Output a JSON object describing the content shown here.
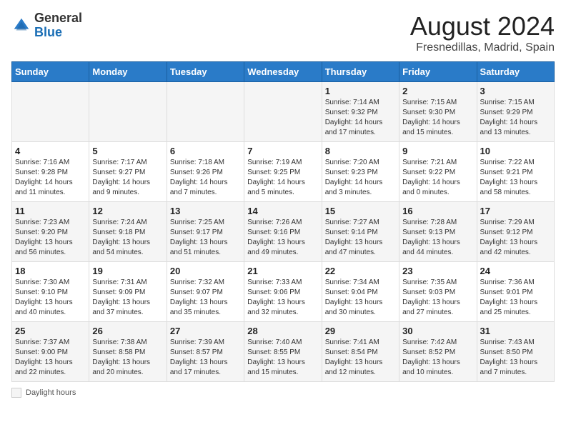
{
  "header": {
    "logo_general": "General",
    "logo_blue": "Blue",
    "month_year": "August 2024",
    "location": "Fresnedillas, Madrid, Spain"
  },
  "days_of_week": [
    "Sunday",
    "Monday",
    "Tuesday",
    "Wednesday",
    "Thursday",
    "Friday",
    "Saturday"
  ],
  "weeks": [
    [
      {
        "day": "",
        "info": ""
      },
      {
        "day": "",
        "info": ""
      },
      {
        "day": "",
        "info": ""
      },
      {
        "day": "",
        "info": ""
      },
      {
        "day": "1",
        "info": "Sunrise: 7:14 AM\nSunset: 9:32 PM\nDaylight: 14 hours\nand 17 minutes."
      },
      {
        "day": "2",
        "info": "Sunrise: 7:15 AM\nSunset: 9:30 PM\nDaylight: 14 hours\nand 15 minutes."
      },
      {
        "day": "3",
        "info": "Sunrise: 7:15 AM\nSunset: 9:29 PM\nDaylight: 14 hours\nand 13 minutes."
      }
    ],
    [
      {
        "day": "4",
        "info": "Sunrise: 7:16 AM\nSunset: 9:28 PM\nDaylight: 14 hours\nand 11 minutes."
      },
      {
        "day": "5",
        "info": "Sunrise: 7:17 AM\nSunset: 9:27 PM\nDaylight: 14 hours\nand 9 minutes."
      },
      {
        "day": "6",
        "info": "Sunrise: 7:18 AM\nSunset: 9:26 PM\nDaylight: 14 hours\nand 7 minutes."
      },
      {
        "day": "7",
        "info": "Sunrise: 7:19 AM\nSunset: 9:25 PM\nDaylight: 14 hours\nand 5 minutes."
      },
      {
        "day": "8",
        "info": "Sunrise: 7:20 AM\nSunset: 9:23 PM\nDaylight: 14 hours\nand 3 minutes."
      },
      {
        "day": "9",
        "info": "Sunrise: 7:21 AM\nSunset: 9:22 PM\nDaylight: 14 hours\nand 0 minutes."
      },
      {
        "day": "10",
        "info": "Sunrise: 7:22 AM\nSunset: 9:21 PM\nDaylight: 13 hours\nand 58 minutes."
      }
    ],
    [
      {
        "day": "11",
        "info": "Sunrise: 7:23 AM\nSunset: 9:20 PM\nDaylight: 13 hours\nand 56 minutes."
      },
      {
        "day": "12",
        "info": "Sunrise: 7:24 AM\nSunset: 9:18 PM\nDaylight: 13 hours\nand 54 minutes."
      },
      {
        "day": "13",
        "info": "Sunrise: 7:25 AM\nSunset: 9:17 PM\nDaylight: 13 hours\nand 51 minutes."
      },
      {
        "day": "14",
        "info": "Sunrise: 7:26 AM\nSunset: 9:16 PM\nDaylight: 13 hours\nand 49 minutes."
      },
      {
        "day": "15",
        "info": "Sunrise: 7:27 AM\nSunset: 9:14 PM\nDaylight: 13 hours\nand 47 minutes."
      },
      {
        "day": "16",
        "info": "Sunrise: 7:28 AM\nSunset: 9:13 PM\nDaylight: 13 hours\nand 44 minutes."
      },
      {
        "day": "17",
        "info": "Sunrise: 7:29 AM\nSunset: 9:12 PM\nDaylight: 13 hours\nand 42 minutes."
      }
    ],
    [
      {
        "day": "18",
        "info": "Sunrise: 7:30 AM\nSunset: 9:10 PM\nDaylight: 13 hours\nand 40 minutes."
      },
      {
        "day": "19",
        "info": "Sunrise: 7:31 AM\nSunset: 9:09 PM\nDaylight: 13 hours\nand 37 minutes."
      },
      {
        "day": "20",
        "info": "Sunrise: 7:32 AM\nSunset: 9:07 PM\nDaylight: 13 hours\nand 35 minutes."
      },
      {
        "day": "21",
        "info": "Sunrise: 7:33 AM\nSunset: 9:06 PM\nDaylight: 13 hours\nand 32 minutes."
      },
      {
        "day": "22",
        "info": "Sunrise: 7:34 AM\nSunset: 9:04 PM\nDaylight: 13 hours\nand 30 minutes."
      },
      {
        "day": "23",
        "info": "Sunrise: 7:35 AM\nSunset: 9:03 PM\nDaylight: 13 hours\nand 27 minutes."
      },
      {
        "day": "24",
        "info": "Sunrise: 7:36 AM\nSunset: 9:01 PM\nDaylight: 13 hours\nand 25 minutes."
      }
    ],
    [
      {
        "day": "25",
        "info": "Sunrise: 7:37 AM\nSunset: 9:00 PM\nDaylight: 13 hours\nand 22 minutes."
      },
      {
        "day": "26",
        "info": "Sunrise: 7:38 AM\nSunset: 8:58 PM\nDaylight: 13 hours\nand 20 minutes."
      },
      {
        "day": "27",
        "info": "Sunrise: 7:39 AM\nSunset: 8:57 PM\nDaylight: 13 hours\nand 17 minutes."
      },
      {
        "day": "28",
        "info": "Sunrise: 7:40 AM\nSunset: 8:55 PM\nDaylight: 13 hours\nand 15 minutes."
      },
      {
        "day": "29",
        "info": "Sunrise: 7:41 AM\nSunset: 8:54 PM\nDaylight: 13 hours\nand 12 minutes."
      },
      {
        "day": "30",
        "info": "Sunrise: 7:42 AM\nSunset: 8:52 PM\nDaylight: 13 hours\nand 10 minutes."
      },
      {
        "day": "31",
        "info": "Sunrise: 7:43 AM\nSunset: 8:50 PM\nDaylight: 13 hours\nand 7 minutes."
      }
    ]
  ],
  "footer": {
    "daylight_label": "Daylight hours"
  }
}
